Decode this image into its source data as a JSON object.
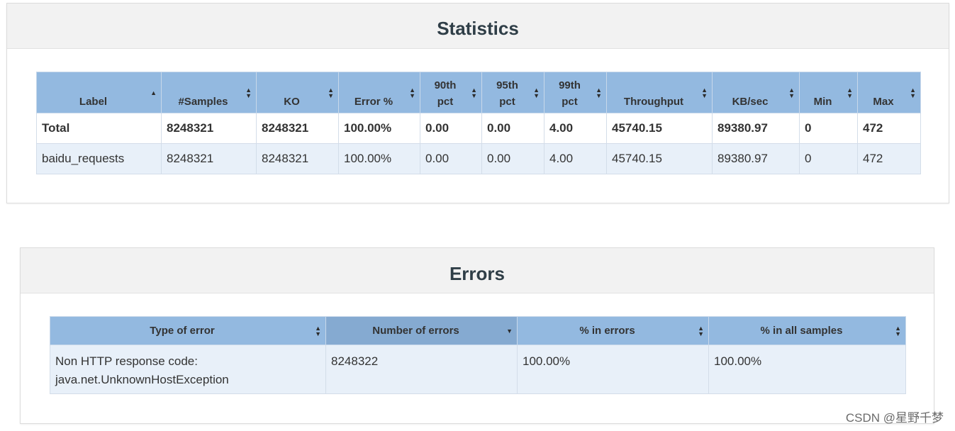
{
  "statistics": {
    "title": "Statistics",
    "columns": [
      {
        "l1": "Label",
        "l2": "",
        "sort": "asc"
      },
      {
        "l1": "#Samples",
        "l2": "",
        "sort": "both"
      },
      {
        "l1": "KO",
        "l2": "",
        "sort": "both"
      },
      {
        "l1": "Error %",
        "l2": "",
        "sort": "both"
      },
      {
        "l1": "90th",
        "l2": "pct",
        "sort": "both"
      },
      {
        "l1": "95th",
        "l2": "pct",
        "sort": "both"
      },
      {
        "l1": "99th",
        "l2": "pct",
        "sort": "both"
      },
      {
        "l1": "Throughput",
        "l2": "",
        "sort": "both"
      },
      {
        "l1": "KB/sec",
        "l2": "",
        "sort": "both"
      },
      {
        "l1": "Min",
        "l2": "",
        "sort": "both"
      },
      {
        "l1": "Max",
        "l2": "",
        "sort": "both"
      }
    ],
    "total_row": [
      "Total",
      "8248321",
      "8248321",
      "100.00%",
      "0.00",
      "0.00",
      "4.00",
      "45740.15",
      "89380.97",
      "0",
      "472"
    ],
    "rows": [
      [
        "baidu_requests",
        "8248321",
        "8248321",
        "100.00%",
        "0.00",
        "0.00",
        "4.00",
        "45740.15",
        "89380.97",
        "0",
        "472"
      ]
    ]
  },
  "errors": {
    "title": "Errors",
    "columns": [
      {
        "label": "Type of error",
        "sort": "both"
      },
      {
        "label": "Number of errors",
        "sort": "desc"
      },
      {
        "label": "% in errors",
        "sort": "both"
      },
      {
        "label": "% in all samples",
        "sort": "both"
      }
    ],
    "rows": [
      {
        "type_line1": "Non HTTP response code:",
        "type_line2": "java.net.UnknownHostException",
        "count": "8248322",
        "pct_errors": "100.00%",
        "pct_all": "100.00%"
      }
    ]
  },
  "watermark": "CSDN @星野千梦",
  "colors": {
    "header_bg": "#93b9e0",
    "sorted_header_bg": "#85aad1",
    "alt_row_bg": "#e8f0f9",
    "panel_head_bg": "#f2f2f2",
    "title_text": "#2f3e47"
  }
}
